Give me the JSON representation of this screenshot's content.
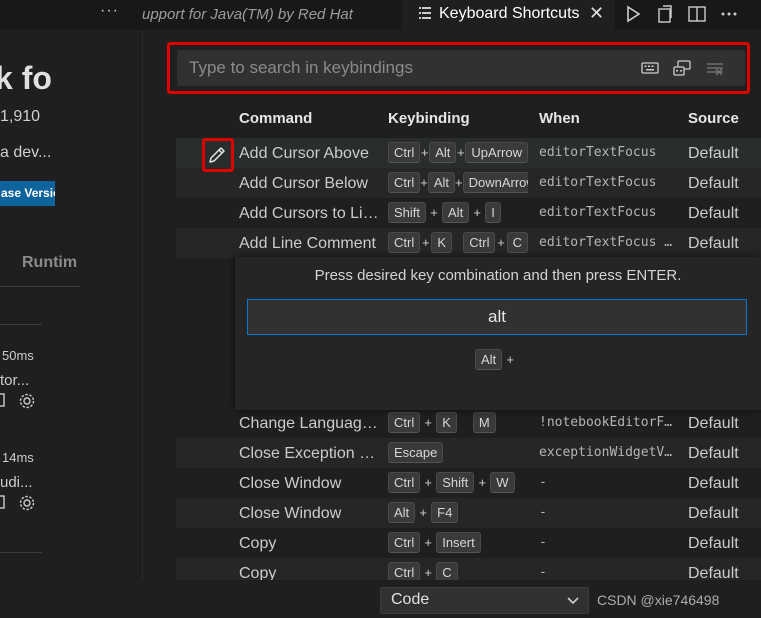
{
  "tabbar": {
    "more": "···",
    "inactive_tab": "upport for Java(TM) by Red Hat",
    "active_tab": "Keyboard Shortcuts",
    "close": "✕"
  },
  "extension": {
    "title": "k fo",
    "count": "1,910",
    "desc": "a dev...",
    "badge": "ase Versio",
    "tab": "Runtim",
    "items": [
      {
        "time": "50ms",
        "name": "tor..."
      },
      {
        "time": "14ms",
        "name": "udi..."
      }
    ]
  },
  "search": {
    "placeholder": "Type to search in keybindings"
  },
  "table": {
    "headers": {
      "command": "Command",
      "keybinding": "Keybinding",
      "when": "When",
      "source": "Source"
    },
    "rows": [
      {
        "command": "Add Cursor Above",
        "keys": [
          "Ctrl",
          "+",
          "Alt",
          "+",
          "UpArrow"
        ],
        "when": "editorTextFocus",
        "source": "Default"
      },
      {
        "command": "Add Cursor Below",
        "keys": [
          "Ctrl",
          "+",
          "Alt",
          "+",
          "DownArrow"
        ],
        "when": "editorTextFocus",
        "source": "Default"
      },
      {
        "command": "Add Cursors to Line Ends",
        "keys": [
          "Shift",
          "+",
          "Alt",
          "+",
          "I"
        ],
        "when": "editorTextFocus",
        "source": "Default"
      },
      {
        "command": "Add Line Comment",
        "keys": [
          "Ctrl",
          "+",
          "K",
          " ",
          "Ctrl",
          "+",
          "C"
        ],
        "when": "editorTextFocus && !editorReadonly",
        "source": "Default"
      },
      {
        "command": "Change Language Mode",
        "keys": [
          "Ctrl",
          "+",
          "K",
          " ",
          "M"
        ],
        "when": "!notebookEditorFocused",
        "source": "Default"
      },
      {
        "command": "Close Exception Widget",
        "keys": [
          "Escape"
        ],
        "when": "exceptionWidgetVisible",
        "source": "Default"
      },
      {
        "command": "Close Window",
        "keys": [
          "Ctrl",
          "+",
          "Shift",
          "+",
          "W"
        ],
        "when": "-",
        "source": "Default"
      },
      {
        "command": "Close Window",
        "keys": [
          "Alt",
          "+",
          "F4"
        ],
        "when": "-",
        "source": "Default"
      },
      {
        "command": "Copy",
        "keys": [
          "Ctrl",
          "+",
          "Insert"
        ],
        "when": "-",
        "source": "Default"
      },
      {
        "command": "Copy",
        "keys": [
          "Ctrl",
          "+",
          "C"
        ],
        "when": "-",
        "source": "Default"
      }
    ]
  },
  "dialog": {
    "message": "Press desired key combination and then press ENTER.",
    "value": "alt",
    "preview_key": "Alt",
    "preview_plus": "+"
  },
  "bottom": {
    "select_value": "Code",
    "watermark": "CSDN @xie746498"
  },
  "colors": {
    "accent": "#0078d4",
    "highlight": "#e00000",
    "badge": "#0e639c",
    "background": "#1f1f1f"
  }
}
